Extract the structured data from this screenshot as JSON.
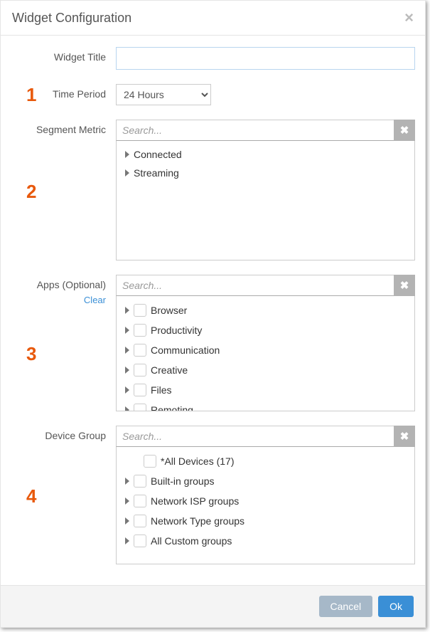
{
  "dialog": {
    "title": "Widget Configuration"
  },
  "steps": {
    "n1": "1",
    "n2": "2",
    "n3": "3",
    "n4": "4"
  },
  "labels": {
    "widget_title": "Widget Title",
    "time_period": "Time Period",
    "segment_metric": "Segment Metric",
    "apps": "Apps (Optional)",
    "clear": "Clear",
    "device_group": "Device Group"
  },
  "fields": {
    "widget_title_value": "",
    "time_period_value": "24 Hours",
    "search_placeholder": "Search..."
  },
  "segment_metric": {
    "items": [
      {
        "label": "Connected"
      },
      {
        "label": "Streaming"
      }
    ]
  },
  "apps": {
    "items": [
      {
        "label": "Browser"
      },
      {
        "label": "Productivity"
      },
      {
        "label": "Communication"
      },
      {
        "label": "Creative"
      },
      {
        "label": "Files"
      },
      {
        "label": "Remoting"
      }
    ]
  },
  "device_group": {
    "items": [
      {
        "label": "*All Devices (17)",
        "leaf": true
      },
      {
        "label": "Built-in groups"
      },
      {
        "label": "Network ISP groups"
      },
      {
        "label": "Network Type groups"
      },
      {
        "label": "All Custom groups"
      }
    ]
  },
  "footer": {
    "cancel": "Cancel",
    "ok": "Ok"
  }
}
